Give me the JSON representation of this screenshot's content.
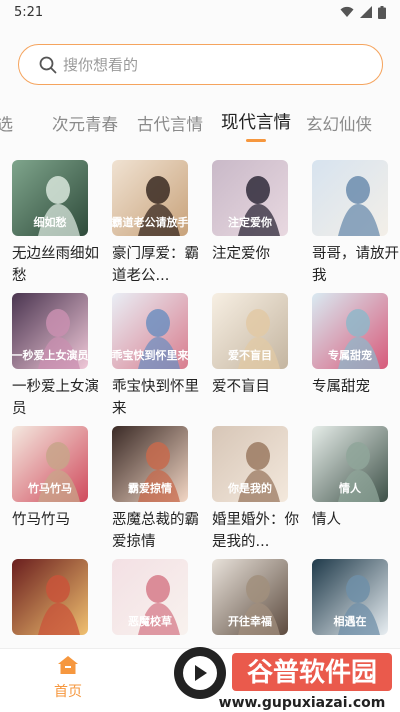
{
  "status_bar": {
    "time": "5:21"
  },
  "search": {
    "placeholder": "搜你想看的"
  },
  "tabs": [
    {
      "label": "精选"
    },
    {
      "label": "次元青春"
    },
    {
      "label": "古代言情"
    },
    {
      "label": "现代言情"
    },
    {
      "label": "玄幻仙侠"
    }
  ],
  "active_tab": "现代言情",
  "books": [
    {
      "title": "无边丝雨细如愁",
      "cover_text": "细如愁"
    },
    {
      "title": "豪门厚爱：霸道老公...",
      "cover_text": "霸道老公请放手"
    },
    {
      "title": "注定爱你",
      "cover_text": "注定爱你"
    },
    {
      "title": "哥哥，请放开我",
      "cover_text": ""
    },
    {
      "title": "一秒爱上女演员",
      "cover_text": "一秒爱上女演员"
    },
    {
      "title": "乖宝快到怀里来",
      "cover_text": "乖宝快到怀里来"
    },
    {
      "title": "爱不盲目",
      "cover_text": "爱不盲目"
    },
    {
      "title": "专属甜宠",
      "cover_text": "专属甜宠"
    },
    {
      "title": "竹马竹马",
      "cover_text": "竹马竹马"
    },
    {
      "title": "恶魔总裁的霸爱掠情",
      "cover_text": "霸爱掠情"
    },
    {
      "title": "婚里婚外：你是我的...",
      "cover_text": "你是我的"
    },
    {
      "title": "情人",
      "cover_text": "情人"
    },
    {
      "title": "",
      "cover_text": ""
    },
    {
      "title": "",
      "cover_text": "恶魔校草"
    },
    {
      "title": "",
      "cover_text": "开往幸福"
    },
    {
      "title": "",
      "cover_text": "相遇在"
    }
  ],
  "bottom_nav": {
    "home_label": "首页"
  },
  "watermark": {
    "name": "谷普软件园",
    "url": "www.gupuxiazai.com"
  },
  "colors": {
    "accent": "#f6973e",
    "search_border": "#f5a45e"
  }
}
